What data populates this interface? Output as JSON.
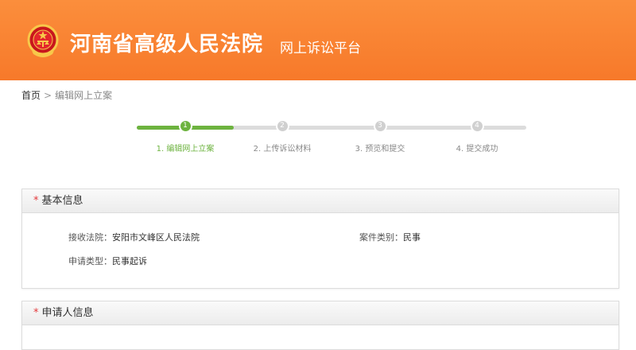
{
  "header": {
    "title": "河南省高级人民法院",
    "subtitle": "网上诉讼平台",
    "colors": {
      "bg": "#f7792a",
      "text": "#ffffff"
    }
  },
  "breadcrumb": {
    "home": "首页",
    "separator": ">",
    "current": "编辑网上立案"
  },
  "steps": {
    "items": [
      {
        "num": "1",
        "label": "1. 编辑网上立案",
        "active": true
      },
      {
        "num": "2",
        "label": "2. 上传诉讼材料",
        "active": false
      },
      {
        "num": "3",
        "label": "3. 预览和提交",
        "active": false
      },
      {
        "num": "4",
        "label": "4. 提交成功",
        "active": false
      }
    ],
    "active_color": "#6db33f",
    "inactive_color": "#d0d0d0"
  },
  "basic_info": {
    "required_mark": "*",
    "title": "基本信息",
    "court_label": "接收法院：",
    "court_value": "安阳市文峰区人民法院",
    "category_label": "案件类别：",
    "category_value": "民事",
    "apply_type_label": "申请类型：",
    "apply_type_value": "民事起诉"
  },
  "applicant_info": {
    "required_mark": "*",
    "title": "申请人信息"
  }
}
